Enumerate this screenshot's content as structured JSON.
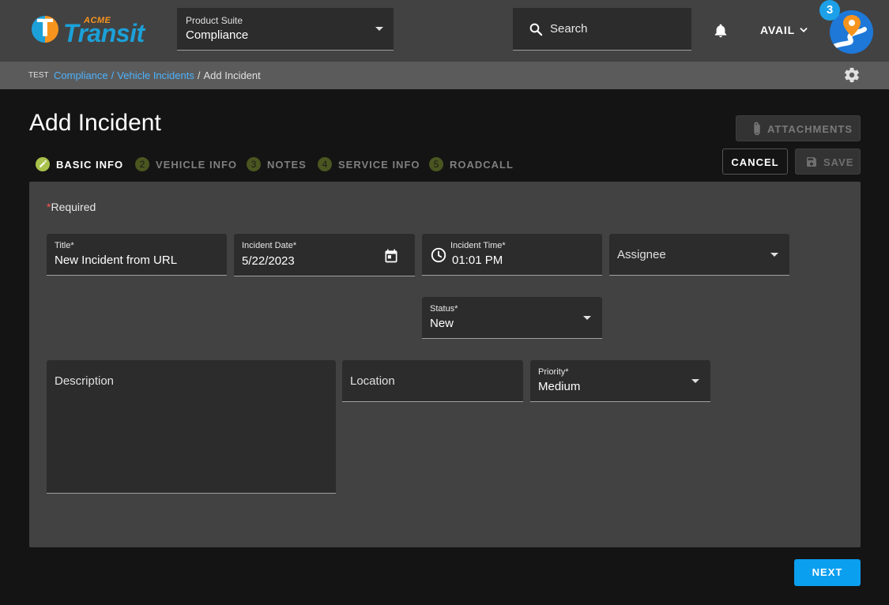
{
  "brand": {
    "acme": "ACME",
    "transit": "Transit",
    "logo_letter": "T"
  },
  "header": {
    "product_suite_label": "Product Suite",
    "product_suite_value": "Compliance",
    "search_label": "Search",
    "username": "AVAIL",
    "notification_count": "3"
  },
  "breadcrumb": {
    "env": "TEST",
    "items": [
      "Compliance",
      "Vehicle Incidents",
      "Add Incident"
    ]
  },
  "page": {
    "title": "Add Incident",
    "attachments_label": "ATTACHMENTS",
    "cancel_label": "CANCEL",
    "save_label": "SAVE",
    "next_label": "NEXT"
  },
  "steps": [
    {
      "num": "",
      "label": "BASIC INFO",
      "active": true
    },
    {
      "num": "2",
      "label": "VEHICLE INFO",
      "active": false
    },
    {
      "num": "3",
      "label": "NOTES",
      "active": false
    },
    {
      "num": "4",
      "label": "SERVICE INFO",
      "active": false
    },
    {
      "num": "5",
      "label": "ROADCALL",
      "active": false
    }
  ],
  "form": {
    "required_star": "*",
    "required_text": "Required",
    "title": {
      "label": "Title*",
      "value": "New Incident from URL"
    },
    "incident_date": {
      "label": "Incident Date*",
      "value": "5/22/2023"
    },
    "incident_time": {
      "label": "Incident Time*",
      "value": "01:01 PM"
    },
    "assignee": {
      "placeholder": "Assignee"
    },
    "status": {
      "label": "Status*",
      "value": "New"
    },
    "description": {
      "placeholder": "Description"
    },
    "location": {
      "placeholder": "Location"
    },
    "priority": {
      "label": "Priority*",
      "value": "Medium"
    }
  },
  "colors": {
    "accent": "#0b9ff0",
    "link": "#4db3ff",
    "step_active": "#a8c24a",
    "required_star": "#ff5252"
  }
}
